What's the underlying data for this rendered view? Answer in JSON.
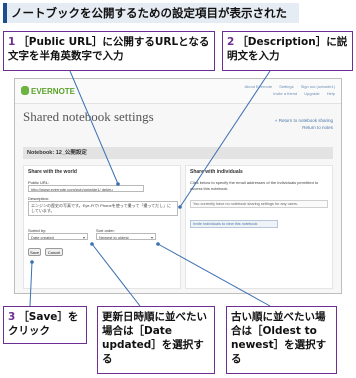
{
  "page_title": "ノートブックを公開するための設定項目が表示された",
  "callouts": {
    "c1": {
      "num": "1",
      "text": "［Public URL］に公開するURLとなる文字を半角英数字で入力"
    },
    "c2": {
      "num": "2",
      "text": "［Description］に説明文を入力"
    },
    "c3": {
      "num": "3",
      "text": "［Save］をクリック"
    },
    "c4": {
      "text": "更新日時順に並べたい場合は［Date updated］を選択する"
    },
    "c5": {
      "text": "古い順に並べたい場合は［Oldest to newest］を選択する"
    }
  },
  "screenshot": {
    "logo": "EVERNOTE",
    "top_links": {
      "line1": [
        "About Evernote",
        "Settings",
        "Sign out (uniwide1)"
      ],
      "line2": [
        "Invite a friend",
        "Upgrade",
        "Help"
      ]
    },
    "heading": "Shared notebook settings",
    "right_links": [
      "« Return to notebook sharing",
      "Return to notes"
    ],
    "notebook_label": "Notebook: 12_公開設定",
    "world_panel": {
      "title": "Share with the world",
      "public_url_label": "Public URL:",
      "public_url_value": "http://www.evernote.com/pub/uniwide1/  dekiru",
      "description_label": "Description:",
      "description_value": "エンジンの歴史の写真です。Eye-Fiでi Phoneを使って撮って「撮ってだし」にしています。",
      "sorted_by_label": "Sorted by:",
      "sorted_by_value": "Date created",
      "sort_order_label": "Sort order:",
      "sort_order_value": "Newest to oldest",
      "save_label": "Save",
      "cancel_label": "Cancel"
    },
    "individuals_panel": {
      "title": "Share with individuals",
      "description": "Click below to specify the email addresses of the individuals permitted to access this notebook.",
      "add_people_text": "You currently have no notebook sharing settings for any users.",
      "invite_text": "Invite individuals to view this notebook"
    }
  },
  "colors": {
    "callout_border": "#6c2f93",
    "title_accent": "#1d4f8e",
    "leader_line": "#3a6fb0"
  }
}
